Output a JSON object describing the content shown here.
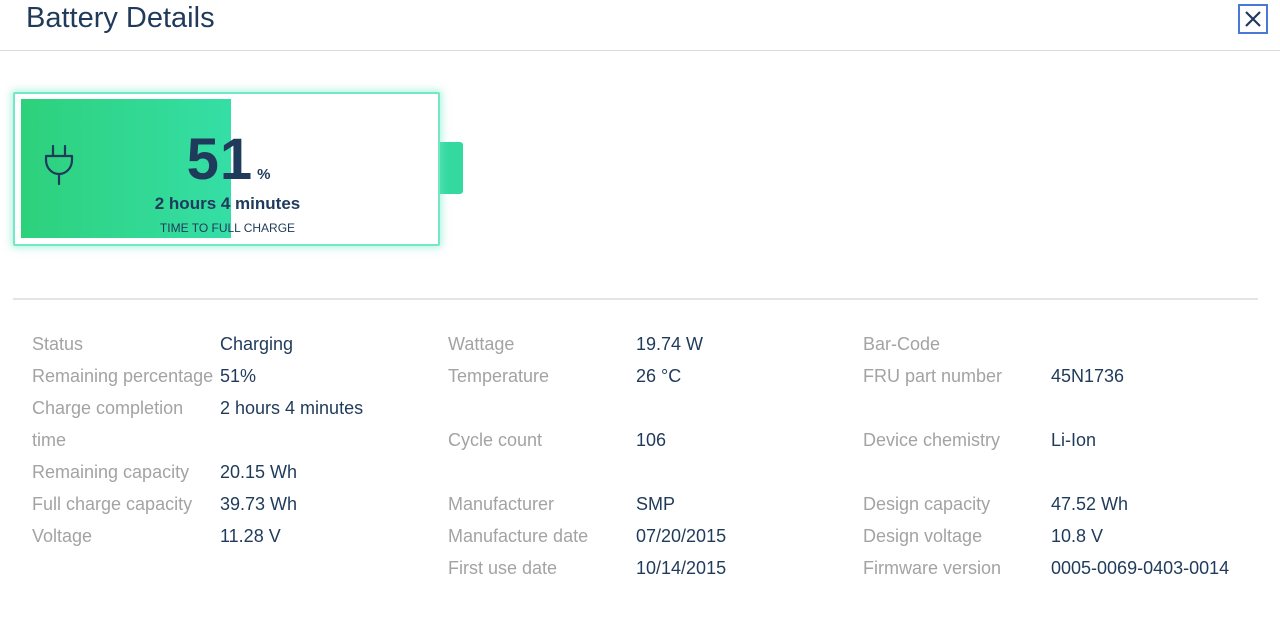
{
  "header": {
    "title": "Battery Details",
    "close_icon": "close-icon"
  },
  "battery": {
    "level_percent": 51,
    "percent_value": "51",
    "percent_sign": "%",
    "time_remaining": "2 hours 4 minutes",
    "time_caption": "TIME TO FULL CHARGE",
    "icon": "plug-icon",
    "fill_color": "#2dd17b",
    "border_color": "#74e8c4"
  },
  "details": {
    "col1": [
      {
        "label": "Status",
        "value": "Charging"
      },
      {
        "label": "Remaining percentage",
        "value": "51%"
      },
      {
        "label": "Charge completion time",
        "value": "2 hours 4 minutes"
      },
      {
        "label": "Remaining capacity",
        "value": "20.15 Wh"
      },
      {
        "label": "Full charge capacity",
        "value": "39.73 Wh"
      },
      {
        "label": "Voltage",
        "value": "11.28 V"
      }
    ],
    "col2": [
      {
        "label": "Wattage",
        "value": "19.74 W"
      },
      {
        "label": "Temperature",
        "value": "26 °C"
      },
      {
        "label": "Cycle count",
        "value": "106"
      },
      {
        "label": "Manufacturer",
        "value": "SMP"
      },
      {
        "label": "Manufacture date",
        "value": "07/20/2015"
      },
      {
        "label": "First use date",
        "value": "10/14/2015"
      }
    ],
    "col3": [
      {
        "label": "Bar-Code",
        "value": ""
      },
      {
        "label": "FRU part number",
        "value": "45N1736"
      },
      {
        "label": "Device chemistry",
        "value": "Li-Ion"
      },
      {
        "label": "Design capacity",
        "value": "47.52 Wh"
      },
      {
        "label": "Design voltage",
        "value": "10.8 V"
      },
      {
        "label": "Firmware version",
        "value": "0005-0069-0403-0014"
      }
    ]
  }
}
